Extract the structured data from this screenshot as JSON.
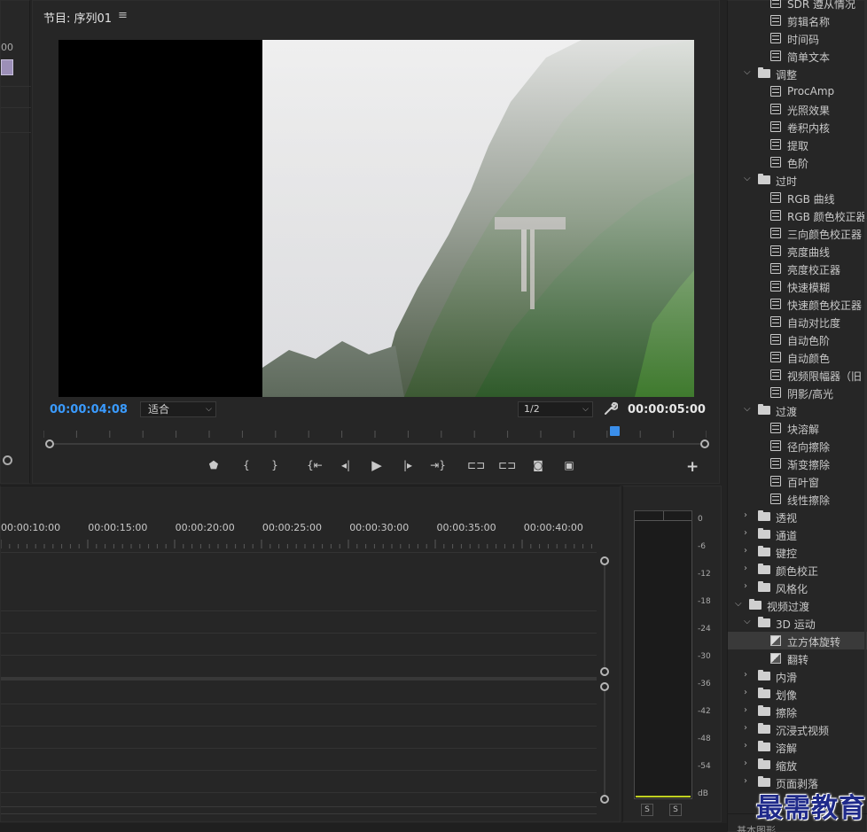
{
  "left_panel": {
    "timecode_fragment": "00"
  },
  "program": {
    "title": "节目: 序列01",
    "menu_glyph": "≡",
    "current_timecode": "00:00:04:08",
    "zoom": "适合",
    "resolution": "1/2",
    "duration_timecode": "00:00:05:00",
    "transport_glyphs": {
      "marker": "⬟",
      "mark_in": "{",
      "mark_out": "}",
      "go_in": "{⇤",
      "step_back": "◂|",
      "play": "▶",
      "step_forward": "|▸",
      "go_out": "⇥}",
      "lift": "⊏⊐",
      "extract": "⊏⊐",
      "export_frame": "◙",
      "compare": "▣",
      "add": "+"
    }
  },
  "effects": {
    "items": [
      {
        "type": "effect",
        "label": "SDR 遵从情况",
        "depth": 2
      },
      {
        "type": "effect",
        "label": "剪辑名称",
        "depth": 2
      },
      {
        "type": "effect",
        "label": "时间码",
        "depth": 2
      },
      {
        "type": "effect",
        "label": "简单文本",
        "depth": 2
      },
      {
        "type": "folder",
        "label": "调整",
        "depth": 1,
        "open": true
      },
      {
        "type": "effect",
        "label": "ProcAmp",
        "depth": 2
      },
      {
        "type": "effect",
        "label": "光照效果",
        "depth": 2
      },
      {
        "type": "effect",
        "label": "卷积内核",
        "depth": 2
      },
      {
        "type": "effect",
        "label": "提取",
        "depth": 2
      },
      {
        "type": "effect",
        "label": "色阶",
        "depth": 2
      },
      {
        "type": "folder",
        "label": "过时",
        "depth": 1,
        "open": true
      },
      {
        "type": "effect",
        "label": "RGB 曲线",
        "depth": 2
      },
      {
        "type": "effect",
        "label": "RGB 颜色校正器",
        "depth": 2
      },
      {
        "type": "effect",
        "label": "三向颜色校正器",
        "depth": 2
      },
      {
        "type": "effect",
        "label": "亮度曲线",
        "depth": 2
      },
      {
        "type": "effect",
        "label": "亮度校正器",
        "depth": 2
      },
      {
        "type": "effect",
        "label": "快速模糊",
        "depth": 2
      },
      {
        "type": "effect",
        "label": "快速颜色校正器",
        "depth": 2
      },
      {
        "type": "effect",
        "label": "自动对比度",
        "depth": 2
      },
      {
        "type": "effect",
        "label": "自动色阶",
        "depth": 2
      },
      {
        "type": "effect",
        "label": "自动颜色",
        "depth": 2
      },
      {
        "type": "effect",
        "label": "视频限幅器（旧",
        "depth": 2
      },
      {
        "type": "effect",
        "label": "阴影/高光",
        "depth": 2
      },
      {
        "type": "folder",
        "label": "过渡",
        "depth": 1,
        "open": true
      },
      {
        "type": "effect",
        "label": "块溶解",
        "depth": 2
      },
      {
        "type": "effect",
        "label": "径向擦除",
        "depth": 2
      },
      {
        "type": "effect",
        "label": "渐变擦除",
        "depth": 2
      },
      {
        "type": "effect",
        "label": "百叶窗",
        "depth": 2
      },
      {
        "type": "effect",
        "label": "线性擦除",
        "depth": 2
      },
      {
        "type": "folder",
        "label": "透视",
        "depth": 1,
        "open": false
      },
      {
        "type": "folder",
        "label": "通道",
        "depth": 1,
        "open": false
      },
      {
        "type": "folder",
        "label": "键控",
        "depth": 1,
        "open": false
      },
      {
        "type": "folder",
        "label": "颜色校正",
        "depth": 1,
        "open": false
      },
      {
        "type": "folder",
        "label": "风格化",
        "depth": 1,
        "open": false
      },
      {
        "type": "folder",
        "label": "视频过渡",
        "depth": 0,
        "open": true
      },
      {
        "type": "folder",
        "label": "3D 运动",
        "depth": 1,
        "open": true
      },
      {
        "type": "transition",
        "label": "立方体旋转",
        "depth": 2,
        "selected": true
      },
      {
        "type": "transition",
        "label": "翻转",
        "depth": 2
      },
      {
        "type": "folder",
        "label": "内滑",
        "depth": 1,
        "open": false
      },
      {
        "type": "folder",
        "label": "划像",
        "depth": 1,
        "open": false
      },
      {
        "type": "folder",
        "label": "擦除",
        "depth": 1,
        "open": false
      },
      {
        "type": "folder",
        "label": "沉浸式视频",
        "depth": 1,
        "open": false
      },
      {
        "type": "folder",
        "label": "溶解",
        "depth": 1,
        "open": false
      },
      {
        "type": "folder",
        "label": "缩放",
        "depth": 1,
        "open": false
      },
      {
        "type": "folder",
        "label": "页面剥落",
        "depth": 1,
        "open": false
      }
    ],
    "bottom_label": "基本图形"
  },
  "timeline": {
    "ruler_labels": [
      "00:00:10:00",
      "00:00:15:00",
      "00:00:20:00",
      "00:00:25:00",
      "00:00:30:00",
      "00:00:35:00",
      "00:00:40:00"
    ]
  },
  "meter": {
    "db_labels": [
      "0",
      "-6",
      "-12",
      "-18",
      "-24",
      "-30",
      "-36",
      "-42",
      "-48",
      "-54",
      "dB"
    ],
    "solo_labels": [
      "S",
      "S"
    ]
  },
  "watermark": "最需教育"
}
